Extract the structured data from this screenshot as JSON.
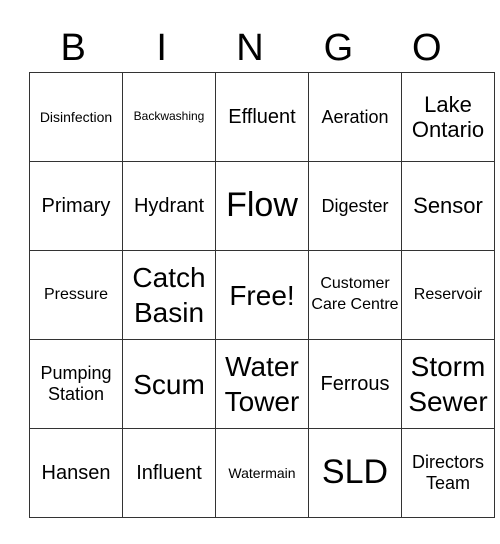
{
  "header": [
    "B",
    "I",
    "N",
    "G",
    "O"
  ],
  "rows": [
    [
      "Disinfection",
      "Backwashing",
      "Effluent",
      "Aeration",
      "Lake Ontario"
    ],
    [
      "Primary",
      "Hydrant",
      "Flow",
      "Digester",
      "Sensor"
    ],
    [
      "Pressure",
      "Catch Basin",
      "Free!",
      "Customer Care Centre",
      "Reservoir"
    ],
    [
      "Pumping Station",
      "Scum",
      "Water Tower",
      "Ferrous",
      "Storm Sewer"
    ],
    [
      "Hansen",
      "Influent",
      "Watermain",
      "SLD",
      "Directors Team"
    ]
  ]
}
